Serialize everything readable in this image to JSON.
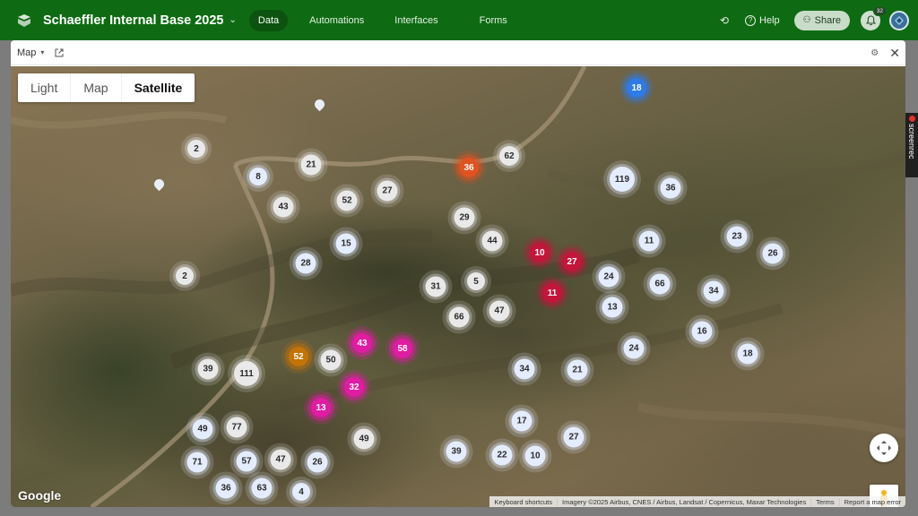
{
  "app": {
    "base_title": "Schaeffler Internal Base 2025",
    "nav": [
      "Data",
      "Automations",
      "Interfaces",
      "Forms"
    ],
    "active_nav": "Data",
    "help_label": "Help",
    "share_label": "Share",
    "notification_count": "32"
  },
  "panel": {
    "name": "Map"
  },
  "map": {
    "mode_options": [
      "Light",
      "Map",
      "Satellite"
    ],
    "selected_mode": "Satellite",
    "watermark": "Google",
    "attribution": [
      "Keyboard shortcuts",
      "Imagery ©2025 Airbus, CNES / Airbus, Landsat / Copernicus, Maxar Technologies",
      "Terms",
      "Report a map error"
    ],
    "cluster_colors": {
      "gray": "#e9e9e9",
      "lavender": "#e4ecff",
      "blue": "#2e7be6",
      "orange": "#e0521f",
      "crimson": "#c2163a",
      "magenta": "#e01ca3",
      "amber": "#c27408"
    },
    "clusters": [
      {
        "label": "18",
        "color": "blue"
      },
      {
        "label": "2",
        "color": "gray"
      },
      {
        "label": "21",
        "color": "gray"
      },
      {
        "label": "36",
        "color": "orange"
      },
      {
        "label": "62",
        "color": "gray"
      },
      {
        "label": "8",
        "color": "lav"
      },
      {
        "label": "27",
        "color": "gray"
      },
      {
        "label": "52",
        "color": "gray"
      },
      {
        "label": "43",
        "color": "gray"
      },
      {
        "label": "119",
        "color": "lav"
      },
      {
        "label": "36",
        "color": "lav"
      },
      {
        "label": "29",
        "color": "gray"
      },
      {
        "label": "15",
        "color": "lav"
      },
      {
        "label": "44",
        "color": "gray"
      },
      {
        "label": "10",
        "color": "crimson"
      },
      {
        "label": "27",
        "color": "crimson"
      },
      {
        "label": "11",
        "color": "lav"
      },
      {
        "label": "23",
        "color": "lav"
      },
      {
        "label": "26",
        "color": "lav"
      },
      {
        "label": "28",
        "color": "lav"
      },
      {
        "label": "2",
        "color": "gray"
      },
      {
        "label": "31",
        "color": "gray"
      },
      {
        "label": "5",
        "color": "gray"
      },
      {
        "label": "11",
        "color": "crimson"
      },
      {
        "label": "24",
        "color": "lav"
      },
      {
        "label": "66",
        "color": "lav"
      },
      {
        "label": "34",
        "color": "lav"
      },
      {
        "label": "13",
        "color": "lav"
      },
      {
        "label": "66",
        "color": "gray"
      },
      {
        "label": "47",
        "color": "gray"
      },
      {
        "label": "16",
        "color": "lav"
      },
      {
        "label": "43",
        "color": "magenta"
      },
      {
        "label": "58",
        "color": "magenta"
      },
      {
        "label": "24",
        "color": "lav"
      },
      {
        "label": "18",
        "color": "lav"
      },
      {
        "label": "52",
        "color": "amber"
      },
      {
        "label": "50",
        "color": "gray"
      },
      {
        "label": "39",
        "color": "gray"
      },
      {
        "label": "111",
        "color": "gray"
      },
      {
        "label": "34",
        "color": "lav"
      },
      {
        "label": "21",
        "color": "lav"
      },
      {
        "label": "32",
        "color": "magenta"
      },
      {
        "label": "13",
        "color": "magenta"
      },
      {
        "label": "17",
        "color": "lav"
      },
      {
        "label": "49",
        "color": "lav"
      },
      {
        "label": "77",
        "color": "gray"
      },
      {
        "label": "49",
        "color": "gray"
      },
      {
        "label": "27",
        "color": "lav"
      },
      {
        "label": "39",
        "color": "lav"
      },
      {
        "label": "22",
        "color": "lav"
      },
      {
        "label": "10",
        "color": "lav"
      },
      {
        "label": "71",
        "color": "lav"
      },
      {
        "label": "57",
        "color": "lav"
      },
      {
        "label": "47",
        "color": "gray"
      },
      {
        "label": "26",
        "color": "lav"
      },
      {
        "label": "36",
        "color": "lav"
      },
      {
        "label": "63",
        "color": "lav"
      },
      {
        "label": "4",
        "color": "lav"
      }
    ]
  },
  "screen_recorder": "screenrec"
}
